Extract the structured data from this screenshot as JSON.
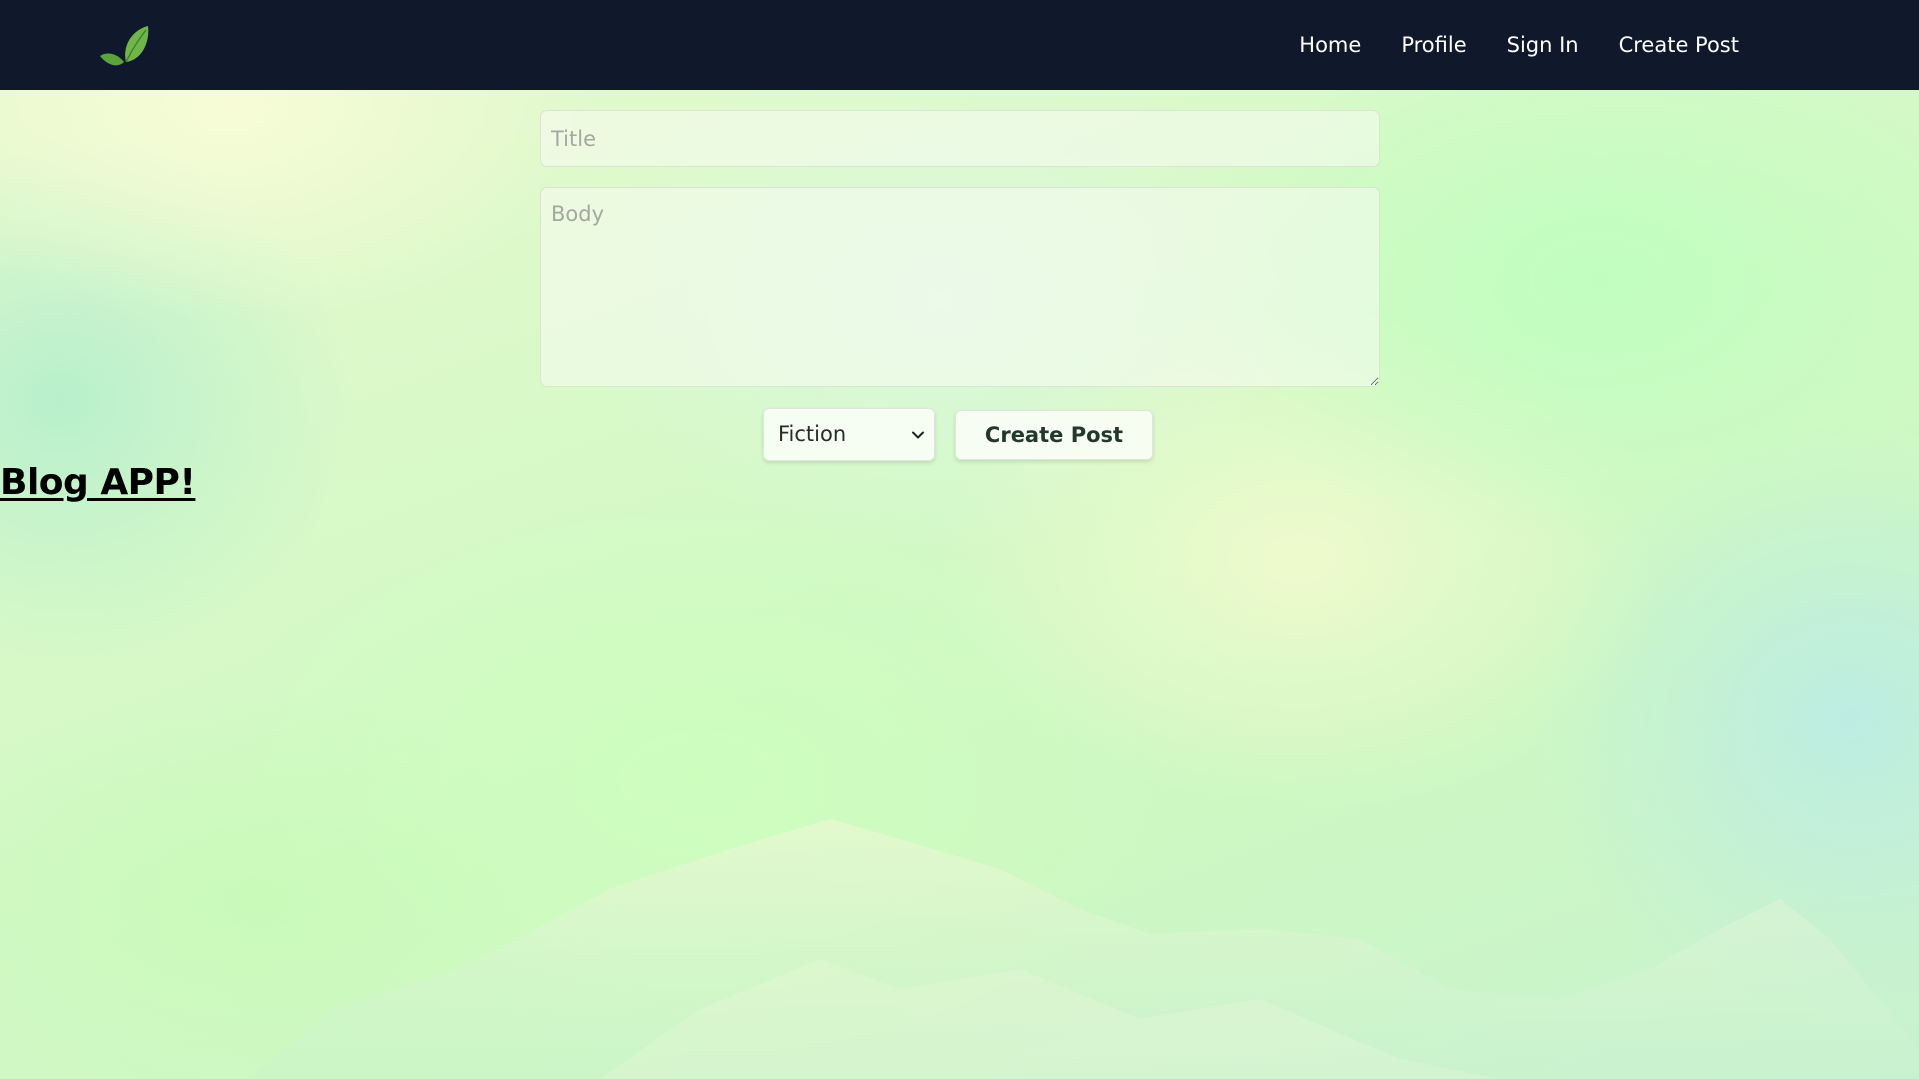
{
  "nav": {
    "logo_icon": "leaf-icon",
    "links": [
      {
        "label": "Home"
      },
      {
        "label": "Profile"
      },
      {
        "label": "Sign In"
      },
      {
        "label": "Create Post"
      }
    ]
  },
  "form": {
    "title_placeholder": "Title",
    "title_value": "",
    "body_placeholder": "Body",
    "body_value": "",
    "category": {
      "selected": "Fiction",
      "icon": "chevron-down-icon"
    },
    "submit_label": "Create Post"
  },
  "heading": "Blog APP!",
  "colors": {
    "navbar": "#10192c",
    "nav_text": "#ffffff",
    "leaf": "#6fb548",
    "background": "#d6f9c7"
  }
}
